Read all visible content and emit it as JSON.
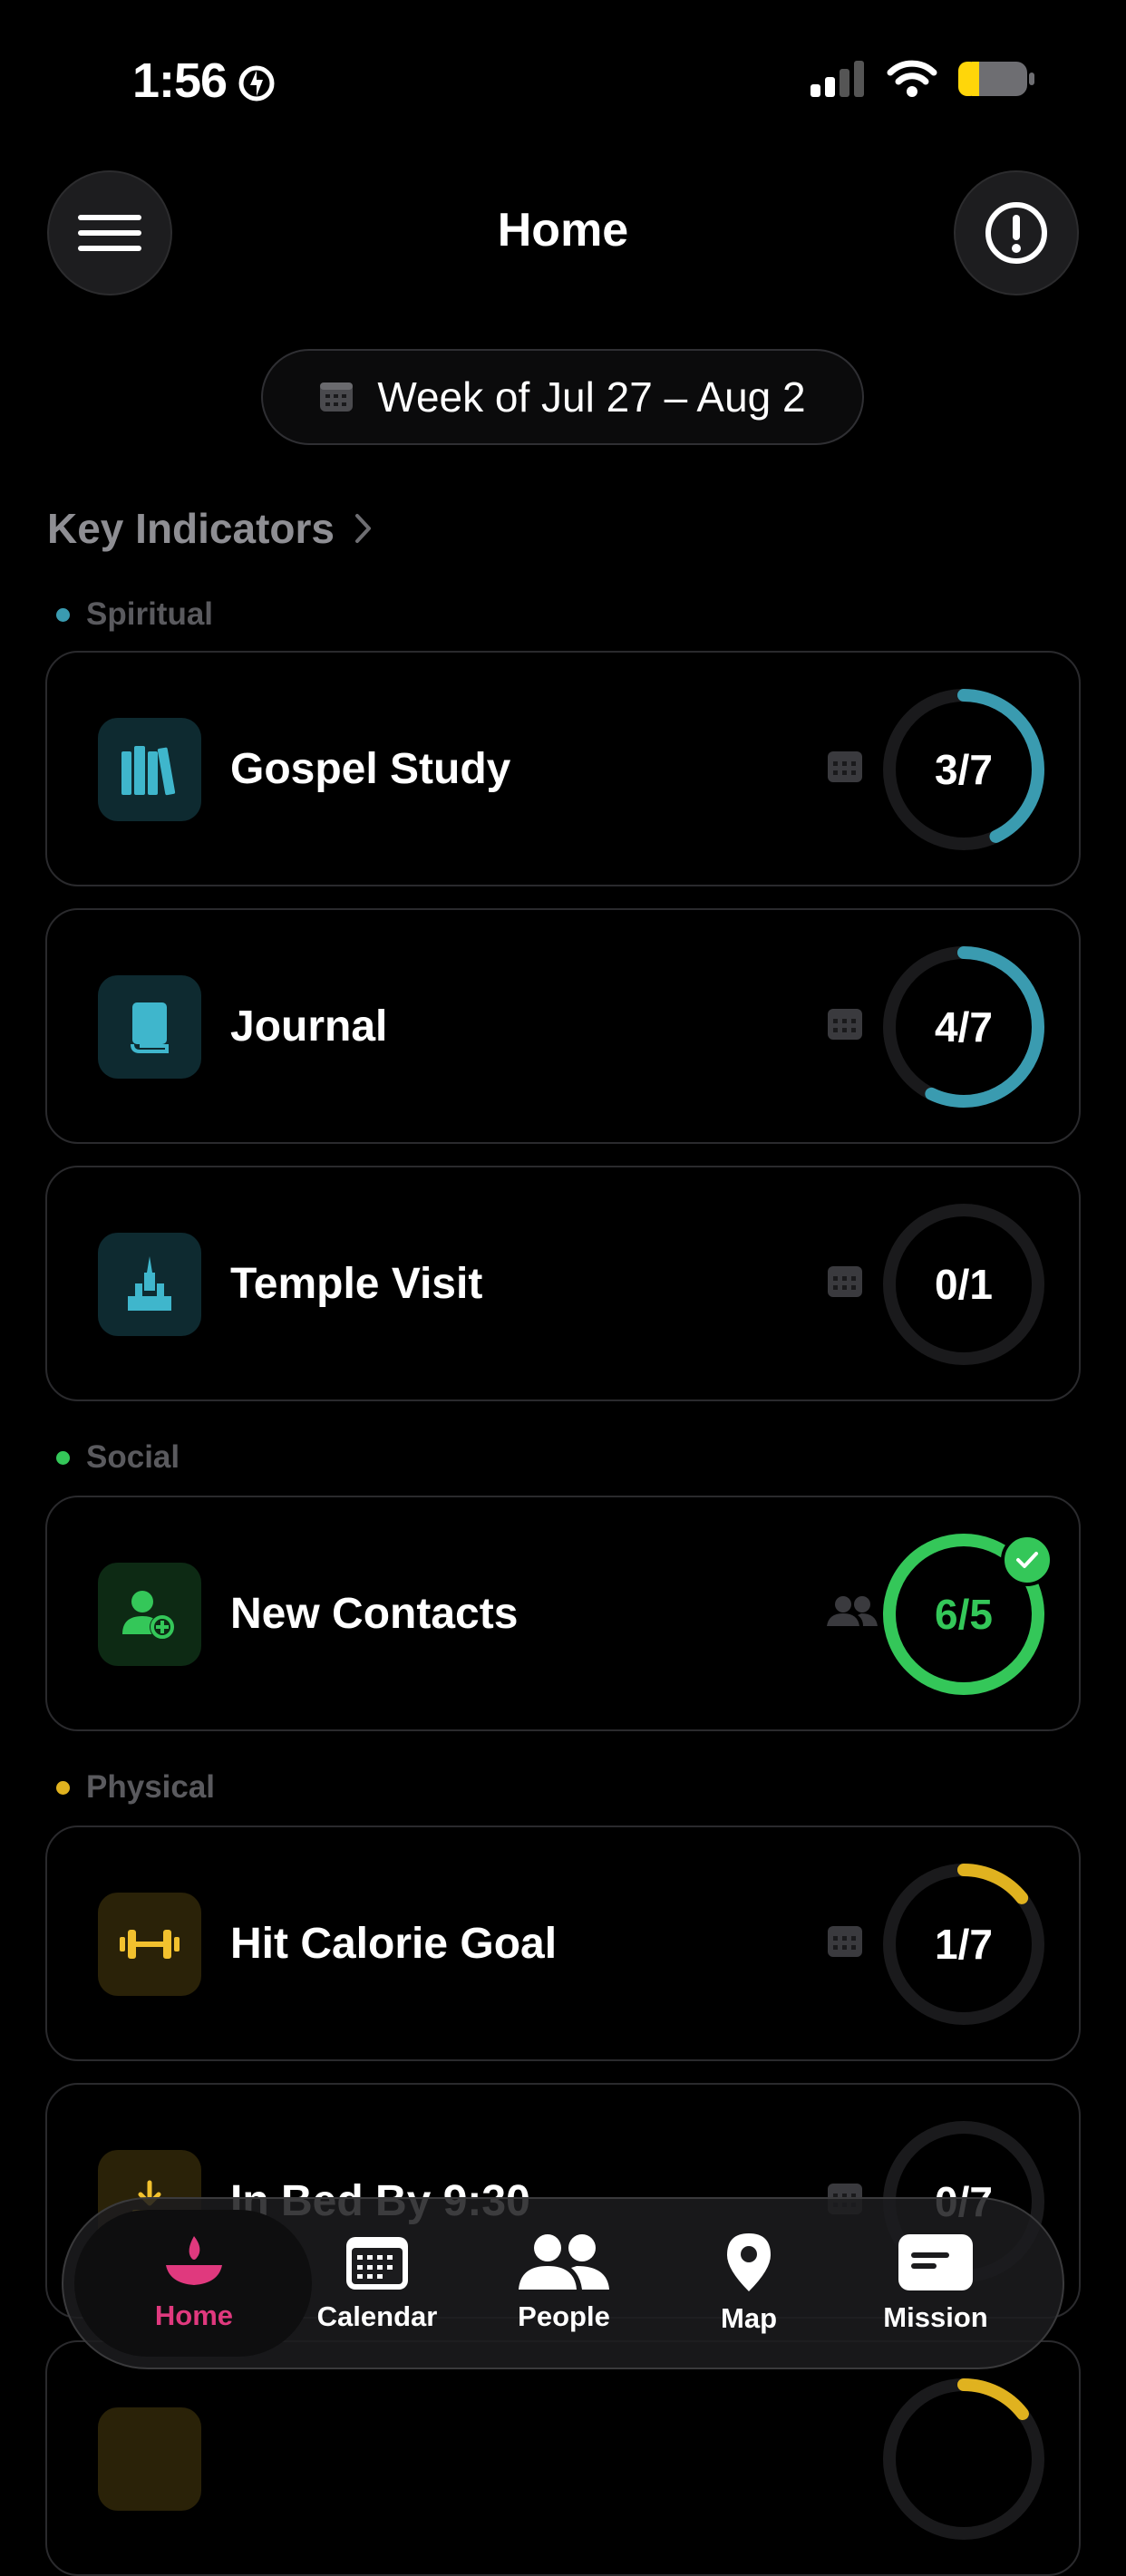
{
  "status_bar": {
    "time": "1:56"
  },
  "header": {
    "title": "Home"
  },
  "week": {
    "label": "Week of Jul 27 – Aug 2"
  },
  "section": {
    "title": "Key Indicators"
  },
  "groups": {
    "spiritual": {
      "label": "Spiritual",
      "color": "#3a9bb0"
    },
    "social": {
      "label": "Social",
      "color": "#34c759"
    },
    "physical": {
      "label": "Physical",
      "color": "#e0b21f"
    }
  },
  "indicators": [
    {
      "title": "Gospel Study",
      "progress": "3/7",
      "done": 3,
      "goal": 7,
      "icon": "books-icon",
      "color": "#3a9bb0"
    },
    {
      "title": "Journal",
      "progress": "4/7",
      "done": 4,
      "goal": 7,
      "icon": "book-icon",
      "color": "#3a9bb0"
    },
    {
      "title": "Temple Visit",
      "progress": "0/1",
      "done": 0,
      "goal": 1,
      "icon": "temple-icon",
      "color": "#3a9bb0"
    },
    {
      "title": "New Contacts",
      "progress": "6/5",
      "done": 6,
      "goal": 5,
      "icon": "add-person-icon",
      "color": "#34c759"
    },
    {
      "title": "Hit Calorie Goal",
      "progress": "1/7",
      "done": 1,
      "goal": 7,
      "icon": "dumbbell-icon",
      "color": "#e0b21f"
    },
    {
      "title": "In Bed By 9:30",
      "progress": "0/7",
      "done": 0,
      "goal": 7,
      "icon": "bed-arrow-icon",
      "color": "#e0b21f"
    }
  ],
  "tabs": [
    {
      "label": "Home",
      "icon": "lamp-icon",
      "active": true
    },
    {
      "label": "Calendar",
      "icon": "calendar-icon"
    },
    {
      "label": "People",
      "icon": "people-icon"
    },
    {
      "label": "Map",
      "icon": "map-pin-icon"
    },
    {
      "label": "Mission",
      "icon": "mission-card-icon"
    }
  ]
}
